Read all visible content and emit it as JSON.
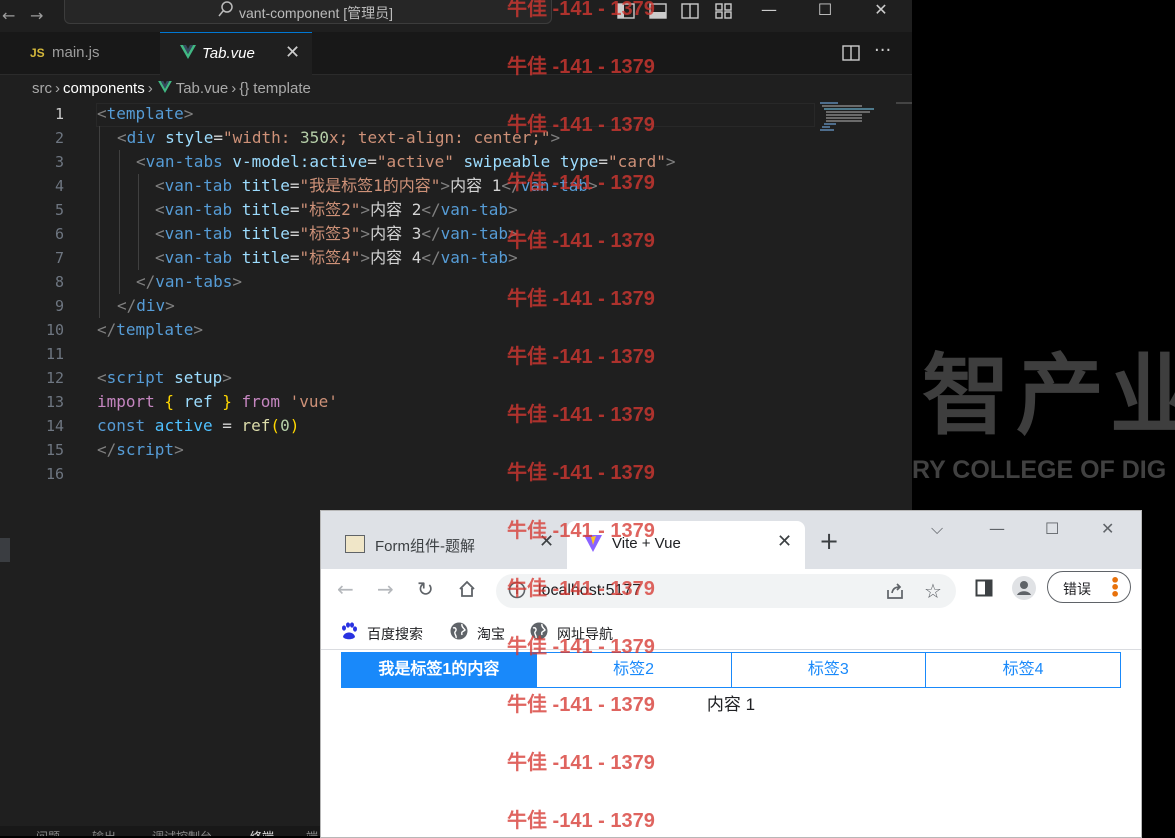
{
  "vscode": {
    "title": "vant-component [管理员]",
    "tabs": [
      {
        "label": "main.js",
        "badge": "JS"
      },
      {
        "label": "Tab.vue"
      }
    ],
    "breadcrumb": [
      "src",
      "components",
      "Tab.vue",
      "template"
    ],
    "line_numbers": [
      "1",
      "2",
      "3",
      "4",
      "5",
      "6",
      "7",
      "8",
      "9",
      "10",
      "11",
      "12",
      "13",
      "14",
      "15",
      "16"
    ],
    "code": {
      "l1": {
        "a": "<",
        "b": "template",
        "c": ">"
      },
      "l2": {
        "a": "<",
        "b": "div",
        "c": " style",
        "d": "=",
        "e": "\"width: ",
        "f": "350",
        "g": "x; text-align: ",
        "h": "center",
        "i": ";\"",
        "j": ">"
      },
      "l3": {
        "a": "<",
        "b": "van-tabs",
        "c": " v-model:active",
        "d": "=",
        "e": "\"active\"",
        "f": " swipeable",
        "g": " type",
        "h": "=",
        "i": "\"card\"",
        "j": ">"
      },
      "l4": {
        "a": "<",
        "b": "van-tab",
        "c": " title",
        "d": "=",
        "e": "\"我是标签1的内容\"",
        "f": ">",
        "g": "内容 1",
        "h": "</",
        "i": "van-tab",
        "j": ">"
      },
      "l5": {
        "a": "<",
        "b": "van-tab",
        "c": " title",
        "d": "=",
        "e": "\"标签2\"",
        "f": ">",
        "g": "内容 2",
        "h": "</",
        "i": "van-tab",
        "j": ">"
      },
      "l6": {
        "a": "<",
        "b": "van-tab",
        "c": " title",
        "d": "=",
        "e": "\"标签3\"",
        "f": ">",
        "g": "内容 3",
        "h": "</",
        "i": "van-tab",
        "j": ">"
      },
      "l7": {
        "a": "<",
        "b": "van-tab",
        "c": " title",
        "d": "=",
        "e": "\"标签4\"",
        "f": ">",
        "g": "内容 4",
        "h": "</",
        "i": "van-tab",
        "j": ">"
      },
      "l8": {
        "a": "</",
        "b": "van-tabs",
        "c": ">"
      },
      "l9": {
        "a": "</",
        "b": "div",
        "c": ">"
      },
      "l10": {
        "a": "</",
        "b": "template",
        "c": ">"
      },
      "l12": {
        "a": "<",
        "b": "script",
        "c": " setup",
        "d": ">"
      },
      "l13": {
        "a": "import",
        "b": " {",
        "c": " ref",
        "d": " }",
        "e": " from",
        "f": " 'vue'"
      },
      "l14": {
        "a": "const",
        "b": " active",
        "c": " = ",
        "d": "ref",
        "e": "(",
        "f": "0",
        "g": ")"
      },
      "l15": {
        "a": "</",
        "b": "script",
        "c": ">"
      }
    },
    "bottom_panel": [
      "问题",
      "输出",
      "调试控制台",
      "终端",
      "端"
    ]
  },
  "wallpaper": {
    "logo_text": "智产业",
    "college_text": "RY COLLEGE OF  DIG"
  },
  "chrome": {
    "tabs": [
      {
        "label": "Form组件-题解"
      },
      {
        "label": "Vite + Vue"
      }
    ],
    "new_tab": "+",
    "url": "localhost:5177",
    "error_button": "错误",
    "bookmarks": [
      {
        "label": "百度搜索"
      },
      {
        "label": "淘宝"
      },
      {
        "label": "网址导航"
      }
    ],
    "van_tabs": [
      {
        "label": "我是标签1的内容",
        "active": true
      },
      {
        "label": "标签2",
        "active": false
      },
      {
        "label": "标签3",
        "active": false
      },
      {
        "label": "标签4",
        "active": false
      }
    ],
    "tab_content": "内容 1"
  },
  "watermark": "牛佳 -141 - 1379",
  "colors": {
    "vant_blue": "#1989fa",
    "watermark": "#d63832",
    "editor_bg": "#1f1f1f"
  }
}
